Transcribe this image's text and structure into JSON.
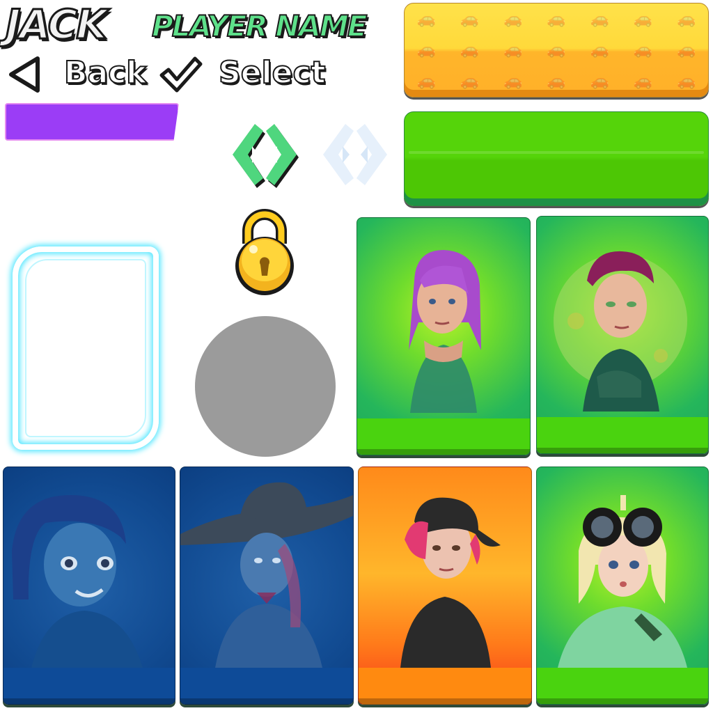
{
  "header": {
    "hero_name": "JACK",
    "player_name_label": "PLAYER NAME"
  },
  "nav": {
    "back_label": "Back",
    "select_label": "Select"
  },
  "icons": {
    "back": "triangle-left-icon",
    "select": "checkmark-icon",
    "swap_active": "swap-arrows-icon",
    "swap_disabled": "swap-arrows-disabled-icon",
    "lock": "padlock-icon",
    "pattern": "car-icon"
  },
  "colors": {
    "accent_green": "#5ee08a",
    "purple_bar": "#9b3df6",
    "yellow_panel": "#ffd93a",
    "green_panel": "#55d40a",
    "neon_glow": "#5ce8ff",
    "card_green": "#25b65b",
    "card_blue": "#124c93",
    "card_orange": "#ff8a1a"
  },
  "cards": [
    {
      "theme": "green",
      "character": "purple-hair-girl"
    },
    {
      "theme": "green",
      "character": "red-hair-tech-girl"
    },
    {
      "theme": "blue",
      "character": "bob-hair-girl",
      "locked": true
    },
    {
      "theme": "blue",
      "character": "cowgirl",
      "locked": true
    },
    {
      "theme": "orange",
      "character": "cap-girl"
    },
    {
      "theme": "green",
      "character": "goggles-girl"
    }
  ]
}
